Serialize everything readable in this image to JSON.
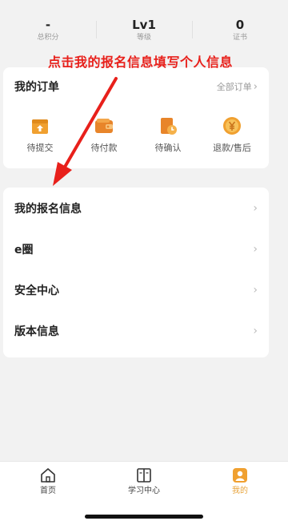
{
  "stats": [
    {
      "value": "-",
      "label": "总积分"
    },
    {
      "value": "Lv1",
      "label": "等级"
    },
    {
      "value": "0",
      "label": "证书"
    }
  ],
  "annotation": "点击我的报名信息填写个人信息",
  "orders": {
    "title": "我的订单",
    "all_label": "全部订单",
    "items": [
      {
        "label": "待提交",
        "icon": "submit-box-icon"
      },
      {
        "label": "待付款",
        "icon": "wallet-icon"
      },
      {
        "label": "待确认",
        "icon": "confirm-clock-icon"
      },
      {
        "label": "退款/售后",
        "icon": "refund-yen-icon"
      }
    ]
  },
  "menu": [
    {
      "label": "我的报名信息"
    },
    {
      "label": "e圈"
    },
    {
      "label": "安全中心"
    },
    {
      "label": "版本信息"
    }
  ],
  "tabbar": [
    {
      "label": "首页",
      "icon": "home-icon"
    },
    {
      "label": "学习中心",
      "icon": "book-icon"
    },
    {
      "label": "我的",
      "icon": "profile-icon"
    }
  ],
  "colors": {
    "accent": "#e8a33b",
    "annotation": "#e8201b",
    "background": "#f2f2f2"
  }
}
